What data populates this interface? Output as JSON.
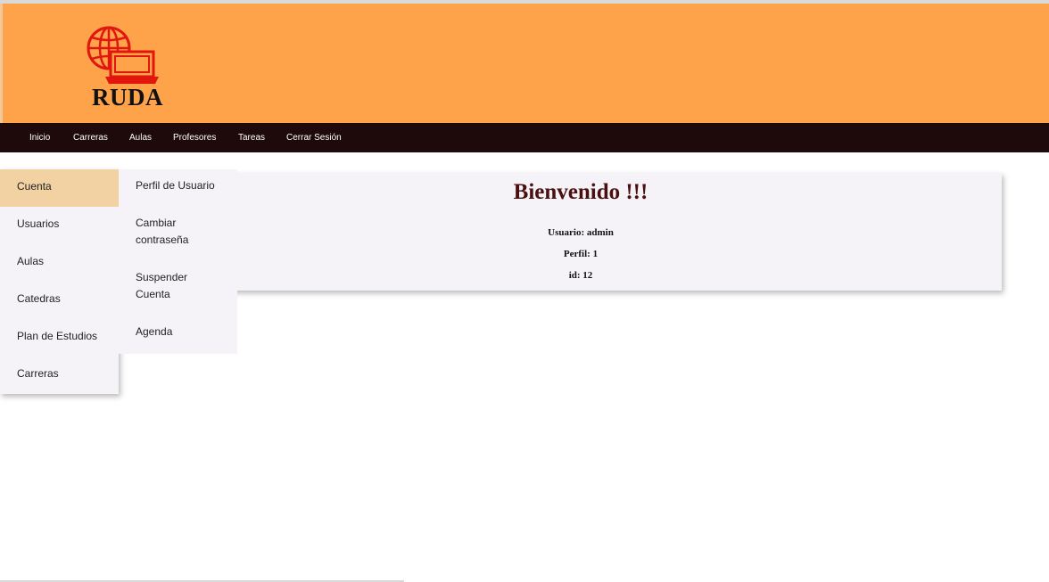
{
  "header": {
    "logo_text": "RUDA"
  },
  "navbar": {
    "items": [
      "Inicio",
      "Carreras",
      "Aulas",
      "Profesores",
      "Tareas",
      "Cerrar Sesión"
    ]
  },
  "sidebar": {
    "items": [
      {
        "label": "Cuenta",
        "active": true
      },
      {
        "label": "Usuarios"
      },
      {
        "label": "Aulas"
      },
      {
        "label": "Catedras"
      },
      {
        "label": "Plan de Estudios"
      },
      {
        "label": "Carreras"
      }
    ]
  },
  "submenu": {
    "items": [
      "Perfil de Usuario",
      "Cambiar contraseña",
      "Suspender Cuenta",
      "Agenda"
    ]
  },
  "welcome": {
    "title": "Bienvenido !!!",
    "usuario": "Usuario: admin",
    "perfil": "Perfil: 1",
    "id": "id: 12"
  },
  "colors": {
    "header_bg": "#fea34a",
    "navbar_bg": "#1e0a0a",
    "active_item_bg": "#f2d1a2",
    "logo_red": "#e0160f",
    "title_color": "#4a0f0f"
  }
}
